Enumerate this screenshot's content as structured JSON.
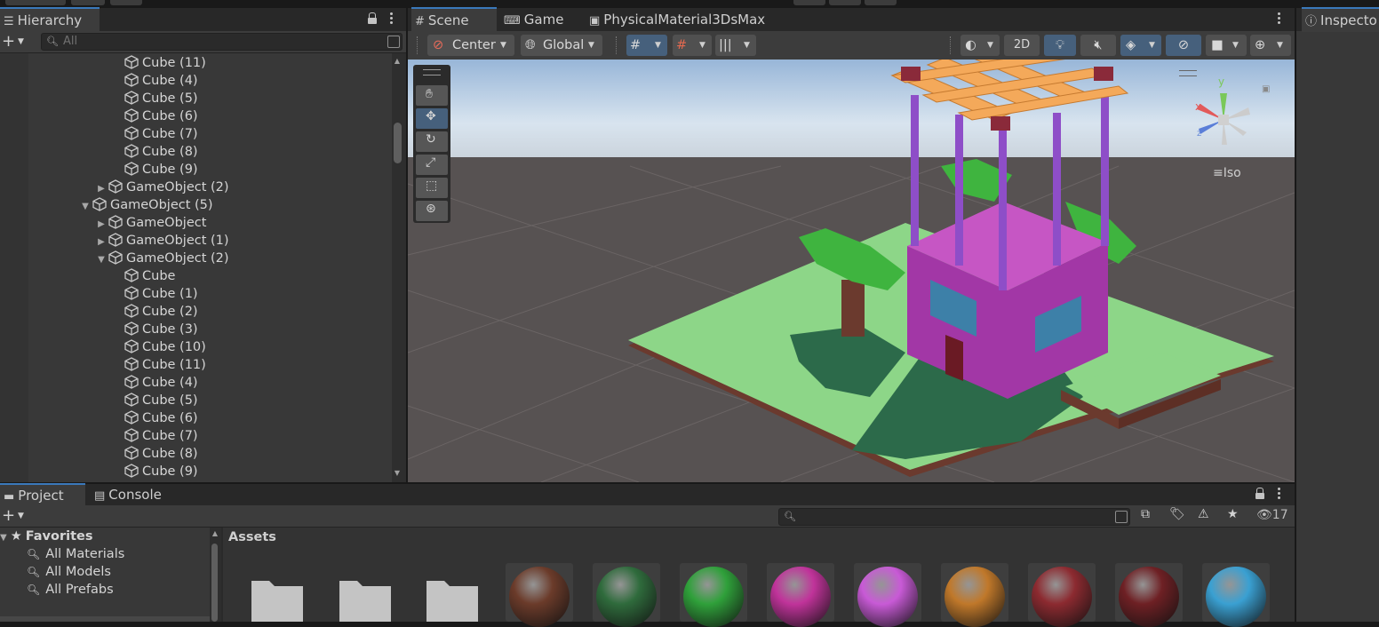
{
  "hierarchy": {
    "tab_label": "Hierarchy",
    "search_placeholder": "All",
    "rows": [
      {
        "label": "Cube (11)",
        "depth": 4,
        "fold": "none"
      },
      {
        "label": "Cube (4)",
        "depth": 4,
        "fold": "none"
      },
      {
        "label": "Cube (5)",
        "depth": 4,
        "fold": "none"
      },
      {
        "label": "Cube (6)",
        "depth": 4,
        "fold": "none"
      },
      {
        "label": "Cube (7)",
        "depth": 4,
        "fold": "none"
      },
      {
        "label": "Cube (8)",
        "depth": 4,
        "fold": "none"
      },
      {
        "label": "Cube (9)",
        "depth": 4,
        "fold": "none"
      },
      {
        "label": "GameObject (2)",
        "depth": 3,
        "fold": "collapsed"
      },
      {
        "label": "GameObject (5)",
        "depth": 2,
        "fold": "expanded"
      },
      {
        "label": "GameObject",
        "depth": 3,
        "fold": "collapsed"
      },
      {
        "label": "GameObject (1)",
        "depth": 3,
        "fold": "collapsed"
      },
      {
        "label": "GameObject (2)",
        "depth": 3,
        "fold": "expanded"
      },
      {
        "label": "Cube",
        "depth": 4,
        "fold": "none"
      },
      {
        "label": "Cube (1)",
        "depth": 4,
        "fold": "none"
      },
      {
        "label": "Cube (2)",
        "depth": 4,
        "fold": "none"
      },
      {
        "label": "Cube (3)",
        "depth": 4,
        "fold": "none"
      },
      {
        "label": "Cube (10)",
        "depth": 4,
        "fold": "none"
      },
      {
        "label": "Cube (11)",
        "depth": 4,
        "fold": "none"
      },
      {
        "label": "Cube (4)",
        "depth": 4,
        "fold": "none"
      },
      {
        "label": "Cube (5)",
        "depth": 4,
        "fold": "none"
      },
      {
        "label": "Cube (6)",
        "depth": 4,
        "fold": "none"
      },
      {
        "label": "Cube (7)",
        "depth": 4,
        "fold": "none"
      },
      {
        "label": "Cube (8)",
        "depth": 4,
        "fold": "none"
      },
      {
        "label": "Cube (9)",
        "depth": 4,
        "fold": "none"
      }
    ]
  },
  "scene": {
    "tabs": [
      {
        "label": "Scene",
        "icon": "scene-grid-icon",
        "active": true
      },
      {
        "label": "Game",
        "icon": "gamepad-icon",
        "active": false
      },
      {
        "label": "PhysicalMaterial3DsMax",
        "icon": "dispenser-icon",
        "active": false
      }
    ],
    "pivot_label": "Center",
    "space_label": "Global",
    "mode_2d_label": "2D",
    "view_mode_label": "Iso",
    "gizmo_axes": {
      "y": "y",
      "x": "x",
      "z": "z"
    }
  },
  "inspector": {
    "tab_label": "Inspecto"
  },
  "project": {
    "tabs": [
      {
        "label": "Project",
        "icon": "folder-icon",
        "active": true
      },
      {
        "label": "Console",
        "icon": "console-icon",
        "active": false
      }
    ],
    "visible_count": "17",
    "favorites": {
      "title": "Favorites",
      "items": [
        "All Materials",
        "All Models",
        "All Prefabs"
      ]
    },
    "breadcrumb": "Assets",
    "material_colors": [
      "#6b3b2a",
      "#2f6b3c",
      "#2fa03a",
      "#c0339a",
      "#c85ad6",
      "#c0782a",
      "#8c2a30",
      "#6e2024",
      "#3aa0d2"
    ]
  },
  "colors": {
    "accent_blue": "#46607c",
    "tab_highlight": "#3a79bb",
    "panel_bg": "#383838",
    "ground_green": "#8ed98a",
    "house_purple": "#a237a6"
  }
}
